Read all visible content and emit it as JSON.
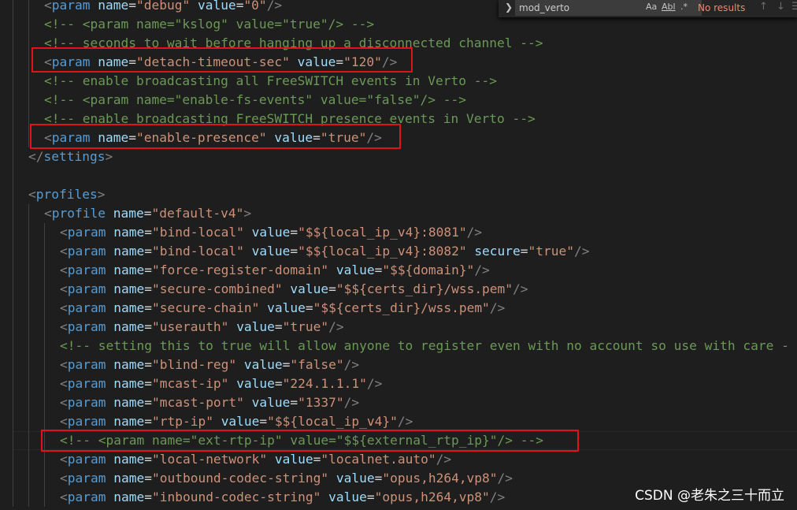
{
  "find_widget": {
    "toggle_glyph": "❯",
    "search_value": "mod_verto",
    "match_case": "Aa",
    "whole_word": "Abl",
    "regex": ".*",
    "status": "No results",
    "prev_glyph": "↑",
    "next_glyph": "↓",
    "close_glyph": "☰"
  },
  "watermark": "CSDN @老朱之三十而立",
  "colors": {
    "background": "#1e1e1e",
    "comment": "#6a9955",
    "tag": "#569cd6",
    "attribute": "#9cdcfe",
    "string": "#ce9178",
    "punctuation": "#808080",
    "highlight_box": "#e0131c"
  },
  "code_lines": [
    {
      "indent": 1,
      "tokens": [
        {
          "t": "p",
          "v": "<"
        },
        {
          "t": "t",
          "v": "param"
        },
        {
          "t": "x",
          "v": " "
        },
        {
          "t": "a",
          "v": "name"
        },
        {
          "t": "x",
          "v": "="
        },
        {
          "t": "s",
          "v": "\"debug\""
        },
        {
          "t": "x",
          "v": " "
        },
        {
          "t": "a",
          "v": "value"
        },
        {
          "t": "x",
          "v": "="
        },
        {
          "t": "s",
          "v": "\"0\""
        },
        {
          "t": "p",
          "v": "/>"
        }
      ]
    },
    {
      "indent": 1,
      "tokens": [
        {
          "t": "c",
          "v": "<!-- <param name=\"kslog\" value=\"true\"/> -->"
        }
      ]
    },
    {
      "indent": 1,
      "tokens": [
        {
          "t": "c",
          "v": "<!-- seconds to wait before hanging up a disconnected channel -->"
        }
      ]
    },
    {
      "indent": 1,
      "tokens": [
        {
          "t": "p",
          "v": "<"
        },
        {
          "t": "t",
          "v": "param"
        },
        {
          "t": "x",
          "v": " "
        },
        {
          "t": "a",
          "v": "name"
        },
        {
          "t": "x",
          "v": "="
        },
        {
          "t": "s",
          "v": "\"detach-timeout-sec\""
        },
        {
          "t": "x",
          "v": " "
        },
        {
          "t": "a",
          "v": "value"
        },
        {
          "t": "x",
          "v": "="
        },
        {
          "t": "s",
          "v": "\"120\""
        },
        {
          "t": "p",
          "v": "/>"
        }
      ]
    },
    {
      "indent": 1,
      "tokens": [
        {
          "t": "c",
          "v": "<!-- enable broadcasting all FreeSWITCH events in Verto -->"
        }
      ]
    },
    {
      "indent": 1,
      "tokens": [
        {
          "t": "c",
          "v": "<!-- <param name=\"enable-fs-events\" value=\"false\"/> -->"
        }
      ]
    },
    {
      "indent": 1,
      "tokens": [
        {
          "t": "c",
          "v": "<!-- enable broadcasting FreeSWITCH presence events in Verto -->"
        }
      ]
    },
    {
      "indent": 1,
      "tokens": [
        {
          "t": "p",
          "v": "<"
        },
        {
          "t": "t",
          "v": "param"
        },
        {
          "t": "x",
          "v": " "
        },
        {
          "t": "a",
          "v": "name"
        },
        {
          "t": "x",
          "v": "="
        },
        {
          "t": "s",
          "v": "\"enable-presence\""
        },
        {
          "t": "x",
          "v": " "
        },
        {
          "t": "a",
          "v": "value"
        },
        {
          "t": "x",
          "v": "="
        },
        {
          "t": "s",
          "v": "\"true\""
        },
        {
          "t": "p",
          "v": "/>"
        }
      ]
    },
    {
      "indent": 0,
      "tokens": [
        {
          "t": "p",
          "v": "</"
        },
        {
          "t": "t",
          "v": "settings"
        },
        {
          "t": "p",
          "v": ">"
        }
      ]
    },
    {
      "indent": 0,
      "tokens": []
    },
    {
      "indent": 0,
      "tokens": [
        {
          "t": "p",
          "v": "<"
        },
        {
          "t": "t",
          "v": "profiles"
        },
        {
          "t": "p",
          "v": ">"
        }
      ]
    },
    {
      "indent": 1,
      "tokens": [
        {
          "t": "p",
          "v": "<"
        },
        {
          "t": "t",
          "v": "profile"
        },
        {
          "t": "x",
          "v": " "
        },
        {
          "t": "a",
          "v": "name"
        },
        {
          "t": "x",
          "v": "="
        },
        {
          "t": "s",
          "v": "\"default-v4\""
        },
        {
          "t": "p",
          "v": ">"
        }
      ]
    },
    {
      "indent": 2,
      "tokens": [
        {
          "t": "p",
          "v": "<"
        },
        {
          "t": "t",
          "v": "param"
        },
        {
          "t": "x",
          "v": " "
        },
        {
          "t": "a",
          "v": "name"
        },
        {
          "t": "x",
          "v": "="
        },
        {
          "t": "s",
          "v": "\"bind-local\""
        },
        {
          "t": "x",
          "v": " "
        },
        {
          "t": "a",
          "v": "value"
        },
        {
          "t": "x",
          "v": "="
        },
        {
          "t": "s",
          "v": "\"$${local_ip_v4}:8081\""
        },
        {
          "t": "p",
          "v": "/>"
        }
      ]
    },
    {
      "indent": 2,
      "tokens": [
        {
          "t": "p",
          "v": "<"
        },
        {
          "t": "t",
          "v": "param"
        },
        {
          "t": "x",
          "v": " "
        },
        {
          "t": "a",
          "v": "name"
        },
        {
          "t": "x",
          "v": "="
        },
        {
          "t": "s",
          "v": "\"bind-local\""
        },
        {
          "t": "x",
          "v": " "
        },
        {
          "t": "a",
          "v": "value"
        },
        {
          "t": "x",
          "v": "="
        },
        {
          "t": "s",
          "v": "\"$${local_ip_v4}:8082\""
        },
        {
          "t": "x",
          "v": " "
        },
        {
          "t": "a",
          "v": "secure"
        },
        {
          "t": "x",
          "v": "="
        },
        {
          "t": "s",
          "v": "\"true\""
        },
        {
          "t": "p",
          "v": "/>"
        }
      ]
    },
    {
      "indent": 2,
      "tokens": [
        {
          "t": "p",
          "v": "<"
        },
        {
          "t": "t",
          "v": "param"
        },
        {
          "t": "x",
          "v": " "
        },
        {
          "t": "a",
          "v": "name"
        },
        {
          "t": "x",
          "v": "="
        },
        {
          "t": "s",
          "v": "\"force-register-domain\""
        },
        {
          "t": "x",
          "v": " "
        },
        {
          "t": "a",
          "v": "value"
        },
        {
          "t": "x",
          "v": "="
        },
        {
          "t": "s",
          "v": "\"$${domain}\""
        },
        {
          "t": "p",
          "v": "/>"
        }
      ]
    },
    {
      "indent": 2,
      "tokens": [
        {
          "t": "p",
          "v": "<"
        },
        {
          "t": "t",
          "v": "param"
        },
        {
          "t": "x",
          "v": " "
        },
        {
          "t": "a",
          "v": "name"
        },
        {
          "t": "x",
          "v": "="
        },
        {
          "t": "s",
          "v": "\"secure-combined\""
        },
        {
          "t": "x",
          "v": " "
        },
        {
          "t": "a",
          "v": "value"
        },
        {
          "t": "x",
          "v": "="
        },
        {
          "t": "s",
          "v": "\"$${certs_dir}/wss.pem\""
        },
        {
          "t": "p",
          "v": "/>"
        }
      ]
    },
    {
      "indent": 2,
      "tokens": [
        {
          "t": "p",
          "v": "<"
        },
        {
          "t": "t",
          "v": "param"
        },
        {
          "t": "x",
          "v": " "
        },
        {
          "t": "a",
          "v": "name"
        },
        {
          "t": "x",
          "v": "="
        },
        {
          "t": "s",
          "v": "\"secure-chain\""
        },
        {
          "t": "x",
          "v": " "
        },
        {
          "t": "a",
          "v": "value"
        },
        {
          "t": "x",
          "v": "="
        },
        {
          "t": "s",
          "v": "\"$${certs_dir}/wss.pem\""
        },
        {
          "t": "p",
          "v": "/>"
        }
      ]
    },
    {
      "indent": 2,
      "tokens": [
        {
          "t": "p",
          "v": "<"
        },
        {
          "t": "t",
          "v": "param"
        },
        {
          "t": "x",
          "v": " "
        },
        {
          "t": "a",
          "v": "name"
        },
        {
          "t": "x",
          "v": "="
        },
        {
          "t": "s",
          "v": "\"userauth\""
        },
        {
          "t": "x",
          "v": " "
        },
        {
          "t": "a",
          "v": "value"
        },
        {
          "t": "x",
          "v": "="
        },
        {
          "t": "s",
          "v": "\"true\""
        },
        {
          "t": "p",
          "v": "/>"
        }
      ]
    },
    {
      "indent": 2,
      "tokens": [
        {
          "t": "c",
          "v": "<!-- setting this to true will allow anyone to register even with no account so use with care -"
        }
      ]
    },
    {
      "indent": 2,
      "tokens": [
        {
          "t": "p",
          "v": "<"
        },
        {
          "t": "t",
          "v": "param"
        },
        {
          "t": "x",
          "v": " "
        },
        {
          "t": "a",
          "v": "name"
        },
        {
          "t": "x",
          "v": "="
        },
        {
          "t": "s",
          "v": "\"blind-reg\""
        },
        {
          "t": "x",
          "v": " "
        },
        {
          "t": "a",
          "v": "value"
        },
        {
          "t": "x",
          "v": "="
        },
        {
          "t": "s",
          "v": "\"false\""
        },
        {
          "t": "p",
          "v": "/>"
        }
      ]
    },
    {
      "indent": 2,
      "tokens": [
        {
          "t": "p",
          "v": "<"
        },
        {
          "t": "t",
          "v": "param"
        },
        {
          "t": "x",
          "v": " "
        },
        {
          "t": "a",
          "v": "name"
        },
        {
          "t": "x",
          "v": "="
        },
        {
          "t": "s",
          "v": "\"mcast-ip\""
        },
        {
          "t": "x",
          "v": " "
        },
        {
          "t": "a",
          "v": "value"
        },
        {
          "t": "x",
          "v": "="
        },
        {
          "t": "s",
          "v": "\"224.1.1.1\""
        },
        {
          "t": "p",
          "v": "/>"
        }
      ]
    },
    {
      "indent": 2,
      "tokens": [
        {
          "t": "p",
          "v": "<"
        },
        {
          "t": "t",
          "v": "param"
        },
        {
          "t": "x",
          "v": " "
        },
        {
          "t": "a",
          "v": "name"
        },
        {
          "t": "x",
          "v": "="
        },
        {
          "t": "s",
          "v": "\"mcast-port\""
        },
        {
          "t": "x",
          "v": " "
        },
        {
          "t": "a",
          "v": "value"
        },
        {
          "t": "x",
          "v": "="
        },
        {
          "t": "s",
          "v": "\"1337\""
        },
        {
          "t": "p",
          "v": "/>"
        }
      ]
    },
    {
      "indent": 2,
      "tokens": [
        {
          "t": "p",
          "v": "<"
        },
        {
          "t": "t",
          "v": "param"
        },
        {
          "t": "x",
          "v": " "
        },
        {
          "t": "a",
          "v": "name"
        },
        {
          "t": "x",
          "v": "="
        },
        {
          "t": "s",
          "v": "\"rtp-ip\""
        },
        {
          "t": "x",
          "v": " "
        },
        {
          "t": "a",
          "v": "value"
        },
        {
          "t": "x",
          "v": "="
        },
        {
          "t": "s",
          "v": "\"$${local_ip_v4}\""
        },
        {
          "t": "p",
          "v": "/>"
        }
      ]
    },
    {
      "indent": 2,
      "tokens": [
        {
          "t": "c",
          "v": "<!-- <param name=\"ext-rtp-ip\" value=\"$${external_rtp_ip}\"/> -->"
        }
      ]
    },
    {
      "indent": 2,
      "tokens": [
        {
          "t": "p",
          "v": "<"
        },
        {
          "t": "t",
          "v": "param"
        },
        {
          "t": "x",
          "v": " "
        },
        {
          "t": "a",
          "v": "name"
        },
        {
          "t": "x",
          "v": "="
        },
        {
          "t": "s",
          "v": "\"local-network\""
        },
        {
          "t": "x",
          "v": " "
        },
        {
          "t": "a",
          "v": "value"
        },
        {
          "t": "x",
          "v": "="
        },
        {
          "t": "s",
          "v": "\"localnet.auto\""
        },
        {
          "t": "p",
          "v": "/>"
        }
      ]
    },
    {
      "indent": 2,
      "tokens": [
        {
          "t": "p",
          "v": "<"
        },
        {
          "t": "t",
          "v": "param"
        },
        {
          "t": "x",
          "v": " "
        },
        {
          "t": "a",
          "v": "name"
        },
        {
          "t": "x",
          "v": "="
        },
        {
          "t": "s",
          "v": "\"outbound-codec-string\""
        },
        {
          "t": "x",
          "v": " "
        },
        {
          "t": "a",
          "v": "value"
        },
        {
          "t": "x",
          "v": "="
        },
        {
          "t": "s",
          "v": "\"opus,h264,vp8\""
        },
        {
          "t": "p",
          "v": "/>"
        }
      ]
    },
    {
      "indent": 2,
      "tokens": [
        {
          "t": "p",
          "v": "<"
        },
        {
          "t": "t",
          "v": "param"
        },
        {
          "t": "x",
          "v": " "
        },
        {
          "t": "a",
          "v": "name"
        },
        {
          "t": "x",
          "v": "="
        },
        {
          "t": "s",
          "v": "\"inbound-codec-string\""
        },
        {
          "t": "x",
          "v": " "
        },
        {
          "t": "a",
          "v": "value"
        },
        {
          "t": "x",
          "v": "="
        },
        {
          "t": "s",
          "v": "\"opus,h264,vp8\""
        },
        {
          "t": "p",
          "v": "/>"
        }
      ]
    }
  ]
}
